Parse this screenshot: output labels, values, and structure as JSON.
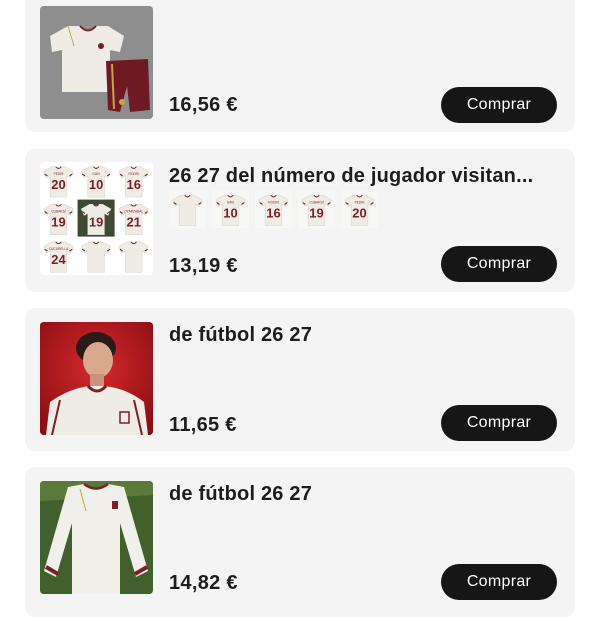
{
  "colors": {
    "card_bg": "#f4f4f5",
    "button_bg": "#161616",
    "button_text": "#ffffff",
    "jersey_white": "#efece6",
    "trim_burgundy": "#7a1f28",
    "trim_gold": "#c9a24a"
  },
  "products": [
    {
      "title": "",
      "price": "16,56 €",
      "button_label": "Comprar",
      "image": "white-jersey-kit-with-burgundy-shorts"
    },
    {
      "title": "26 27 del número de jugador visitan...",
      "price": "13,19 €",
      "button_label": "Comprar",
      "image": "grid-of-player-number-jerseys",
      "grid_numbers": [
        "20",
        "10",
        "16",
        "19",
        "19",
        "21",
        "24",
        "",
        ""
      ],
      "grid_names": [
        "PEDRI",
        "GAVI",
        "RODRI",
        "CUBARSÍ",
        "",
        "OYARZABAL",
        "CUCURELLA",
        "",
        ""
      ],
      "variant_numbers": [
        "",
        "10",
        "16",
        "19",
        "20"
      ],
      "variant_names": [
        "",
        "GAVI",
        "RODRI",
        "CUBARSÍ",
        "PEDRI"
      ]
    },
    {
      "title": "de fútbol 26 27",
      "price": "11,65 €",
      "button_label": "Comprar",
      "image": "model-wearing-white-jersey-red-background"
    },
    {
      "title": "de fútbol 26 27",
      "price": "14,82 €",
      "button_label": "Comprar",
      "image": "long-sleeve-white-jersey"
    }
  ]
}
